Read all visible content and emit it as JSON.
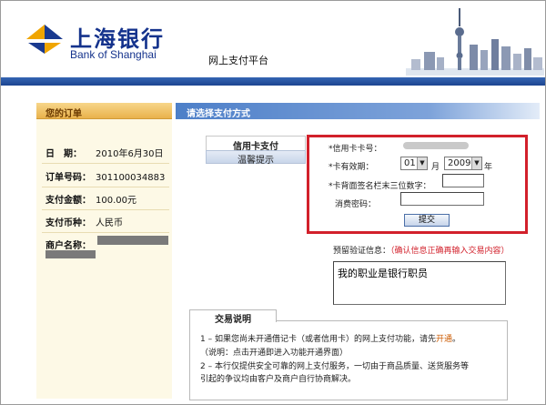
{
  "header": {
    "bank_name_cn": "上海银行",
    "bank_name_en": "Bank of Shanghai",
    "platform_title": "网上支付平台"
  },
  "order_panel": {
    "title": "您的订单",
    "rows": [
      {
        "label": "日　期：",
        "value": "2010年6月30日"
      },
      {
        "label": "订单号码：",
        "value": "301100034883"
      },
      {
        "label": "支付金额：",
        "value": "100.00元"
      },
      {
        "label": "支付币种：",
        "value": "人民币"
      },
      {
        "label": "商户名称：",
        "value": ""
      }
    ]
  },
  "payment": {
    "section_title": "请选择支付方式",
    "tabs": [
      {
        "label": "信用卡支付"
      },
      {
        "label": "温馨提示"
      }
    ],
    "form": {
      "card_number_label": "*信用卡卡号：",
      "expiry_label": "*卡有效期：",
      "expiry_month": "01",
      "month_unit": "月",
      "expiry_year": "2009",
      "year_unit": "年",
      "cvv_label": "*卡背面签名栏末三位数字：",
      "password_label": "消费密码：",
      "submit_label": "提交"
    },
    "verify": {
      "label": "预留验证信息：",
      "warning": "（确认信息正确再输入交易内容）",
      "value": "我的职业是银行职员"
    }
  },
  "notes": {
    "title": "交易说明",
    "lines": [
      {
        "a": "1 – 如果您尚未开通借记卡（或者信用卡）的网上支付功能，请先",
        "link": "开通",
        "b": "。"
      },
      {
        "a": "（说明：点击开通即进入功能开通界面）",
        "link": "",
        "b": ""
      },
      {
        "a": "2 – 本行仅提供安全可靠的网上支付服务，一切由于商品质量、送货服务等",
        "link": "",
        "b": ""
      },
      {
        "a": "引起的争议均由客户及商户自行协商解决。",
        "link": "",
        "b": ""
      }
    ]
  },
  "colors": {
    "brand_blue": "#14328c",
    "highlight_red": "#d2202b",
    "panel_cream": "#fdf9e6"
  }
}
